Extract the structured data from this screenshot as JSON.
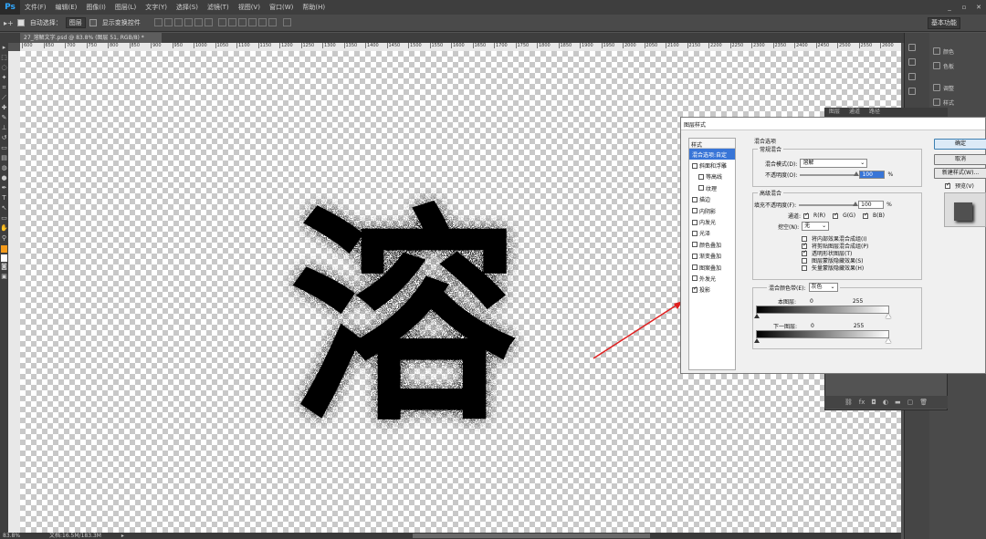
{
  "app": {
    "logo": "Ps"
  },
  "menu": [
    "文件(F)",
    "编辑(E)",
    "图像(I)",
    "图层(L)",
    "文字(Y)",
    "选择(S)",
    "滤镜(T)",
    "视图(V)",
    "窗口(W)",
    "帮助(H)"
  ],
  "window_controls": [
    "_",
    "▫",
    "✕"
  ],
  "options_bar": {
    "auto_select_label": "自动选择：",
    "auto_select_value": "图层",
    "show_transform_label": "显示变换控件",
    "workspace": "基本功能"
  },
  "document_tab": {
    "title": "27_溶解文字.psd @ 83.8% (图层 51, RGB/8) *"
  },
  "ruler_ticks": [
    "600",
    "650",
    "700",
    "750",
    "800",
    "850",
    "900",
    "950",
    "1000",
    "1050",
    "1100",
    "1150",
    "1200",
    "1250",
    "1300",
    "1350",
    "1400",
    "1450",
    "1500",
    "1550",
    "1600",
    "1650",
    "1700",
    "1750",
    "1800",
    "1850",
    "1900",
    "1950",
    "2000",
    "2050",
    "2100",
    "2150",
    "2200",
    "2250",
    "2300",
    "2350",
    "2400",
    "2450",
    "2500",
    "2550",
    "2600"
  ],
  "canvas_text": "溶",
  "status": {
    "zoom": "83.8%",
    "doc": "文档:16.5M/183.3M"
  },
  "right_panels": [
    {
      "label": "颜色",
      "icon": "color-icon"
    },
    {
      "label": "色板",
      "icon": "swatches-icon"
    },
    {
      "label": "调整",
      "icon": "adjustments-icon"
    },
    {
      "label": "样式",
      "icon": "styles-icon"
    }
  ],
  "layers_tabs": [
    "图层",
    "通道",
    "路径"
  ],
  "dialog": {
    "title": "图层样式",
    "styles_header": "样式",
    "styles": [
      {
        "label": "混合选项:自定",
        "selected": true,
        "checkbox": false
      },
      {
        "label": "斜面和浮雕",
        "checked": false,
        "checkbox": true
      },
      {
        "label": "等高线",
        "checked": false,
        "checkbox": true,
        "indent": true
      },
      {
        "label": "纹理",
        "checked": false,
        "checkbox": true,
        "indent": true
      },
      {
        "label": "描边",
        "checked": false,
        "checkbox": true
      },
      {
        "label": "内阴影",
        "checked": false,
        "checkbox": true
      },
      {
        "label": "内发光",
        "checked": false,
        "checkbox": true
      },
      {
        "label": "光泽",
        "checked": false,
        "checkbox": true
      },
      {
        "label": "颜色叠加",
        "checked": false,
        "checkbox": true
      },
      {
        "label": "渐变叠加",
        "checked": false,
        "checkbox": true
      },
      {
        "label": "图案叠加",
        "checked": false,
        "checkbox": true
      },
      {
        "label": "外发光",
        "checked": false,
        "checkbox": true
      },
      {
        "label": "投影",
        "checked": true,
        "checkbox": true
      }
    ],
    "blend_options_title": "混合选项",
    "general_blend_title": "常规混合",
    "blend_mode_label": "混合模式(D):",
    "blend_mode_value": "溶解",
    "opacity_label": "不透明度(O):",
    "opacity_value": "100",
    "opacity_level": 1.0,
    "advanced_blend_title": "高级混合",
    "fill_opacity_label": "填充不透明度(F):",
    "fill_opacity_value": "100",
    "fill_opacity_level": 1.0,
    "percent": "%",
    "channels_label": "通道:",
    "channels": [
      {
        "label": "R(R)",
        "checked": true
      },
      {
        "label": "G(G)",
        "checked": true
      },
      {
        "label": "B(B)",
        "checked": true
      }
    ],
    "knockout_label": "挖空(N):",
    "knockout_value": "无",
    "advanced_options": [
      {
        "label": "将内部效果混合成组(I)",
        "checked": false
      },
      {
        "label": "将剪贴图层混合成组(P)",
        "checked": true
      },
      {
        "label": "透明形状图层(T)",
        "checked": true
      },
      {
        "label": "图层蒙版隐藏效果(S)",
        "checked": false
      },
      {
        "label": "矢量蒙版隐藏效果(H)",
        "checked": false
      }
    ],
    "blend_if_label": "混合颜色带(E):",
    "blend_if_value": "灰色",
    "this_layer_label": "本图层:",
    "this_layer_min": "0",
    "this_layer_max": "255",
    "underlying_label": "下一图层:",
    "underlying_min": "0",
    "underlying_max": "255",
    "ok": "确定",
    "cancel": "取消",
    "new_style": "新建样式(W)...",
    "preview_label": "预览(V)",
    "preview_checked": true
  }
}
